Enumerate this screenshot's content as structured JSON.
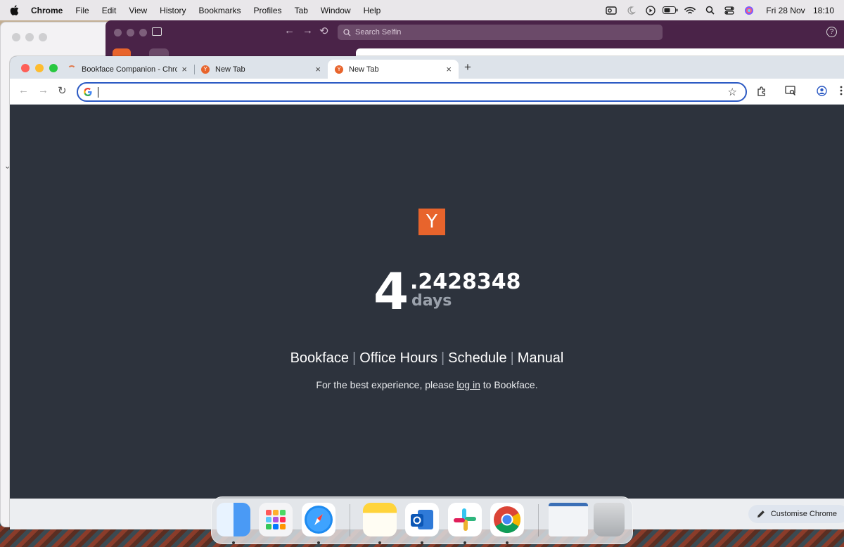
{
  "menubar": {
    "app_name": "Chrome",
    "items": [
      "File",
      "Edit",
      "View",
      "History",
      "Bookmarks",
      "Profiles",
      "Tab",
      "Window",
      "Help"
    ],
    "date": "Fri 28 Nov",
    "time": "18:10"
  },
  "background_app": {
    "search_placeholder": "Search Selfin"
  },
  "tabs": [
    {
      "title": "Bookface Companion - Chrom",
      "active": false
    },
    {
      "title": "New Tab",
      "active": false
    },
    {
      "title": "New Tab",
      "active": true
    }
  ],
  "omnibox": {
    "value": ""
  },
  "page": {
    "logo_letter": "Y",
    "counter_integer": "4",
    "counter_fraction": ".2428348",
    "counter_unit": "days",
    "links": [
      "Bookface",
      "Office Hours",
      "Schedule",
      "Manual"
    ],
    "note_before": "For the best experience, please ",
    "note_link": "log in",
    "note_after": " to Bookface."
  },
  "customise_button": "Customise Chrome",
  "colors": {
    "page_bg": "#2d333d",
    "yc_orange": "#e8642c",
    "omnibox_focus": "#2b59c3"
  },
  "dock": {
    "apps": [
      "finder-icon",
      "launchpad-icon",
      "safari-icon",
      "notes-icon",
      "outlook-icon",
      "slack-icon",
      "chrome-icon",
      "preview-icon",
      "trash-icon"
    ]
  }
}
